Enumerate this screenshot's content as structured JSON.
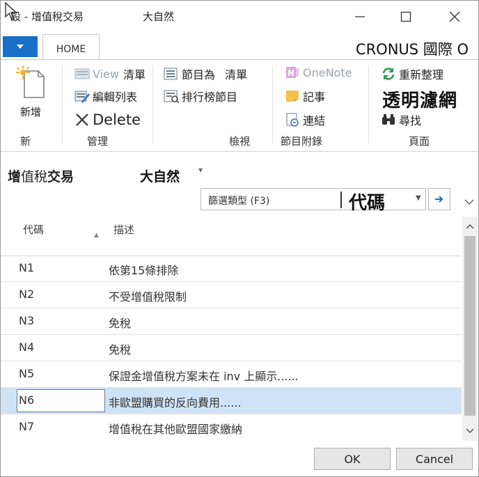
{
  "window": {
    "title": "設 - 增值稅交易",
    "company": "大自然"
  },
  "ribbon": {
    "tab_home": "HOME",
    "company_name": "CRONUS 國際 O",
    "new_label": "新增",
    "group_new": "新",
    "view_label": "View",
    "view_list_label": "清單",
    "edit_list_label": "編輯列表",
    "delete_label": "Delete",
    "group_manage": "管理",
    "show_as_label": "節目為",
    "show_as_list_label": "清單",
    "ranked_label": "排行榜節目",
    "group_view": "檢視",
    "onenote_label": "OneNote",
    "notes_label": "記事",
    "links_label": "連結",
    "group_attachments": "節目附錄",
    "refresh_label": "重新整理",
    "clear_filter_label": "透明濾網",
    "find_label": "尋找",
    "group_page": "頁面"
  },
  "page": {
    "title_part1": "增",
    "title_part2": "值稅",
    "title_part3": "交易",
    "company": "大自然"
  },
  "filter": {
    "type_label": "篩選類型 (F3)",
    "field": "代碼"
  },
  "table": {
    "columns": [
      "代碼",
      "描述"
    ],
    "rows": [
      {
        "code": "N1",
        "desc": "依第15條排除"
      },
      {
        "code": "N2",
        "desc": "不受增值稅限制"
      },
      {
        "code": "N3",
        "desc": "免稅"
      },
      {
        "code": "N4",
        "desc": "免稅"
      },
      {
        "code": "N5",
        "desc": "保證金增值稅方案未在 inv 上顯示......"
      },
      {
        "code": "N6",
        "desc": "非歐盟購買的反向費用......"
      },
      {
        "code": "N7",
        "desc": "增值稅在其他歐盟國家繳納"
      }
    ],
    "selected_code": "N6"
  },
  "footer": {
    "ok_label": "OK",
    "cancel_label": "Cancel"
  },
  "colors": {
    "accent": "#1a6fc8",
    "selected_row": "#cfe3f6",
    "refresh_green": "#2e9a4e",
    "note_yellow": "#f2c24b",
    "onenote_purple": "#b56fc4"
  }
}
